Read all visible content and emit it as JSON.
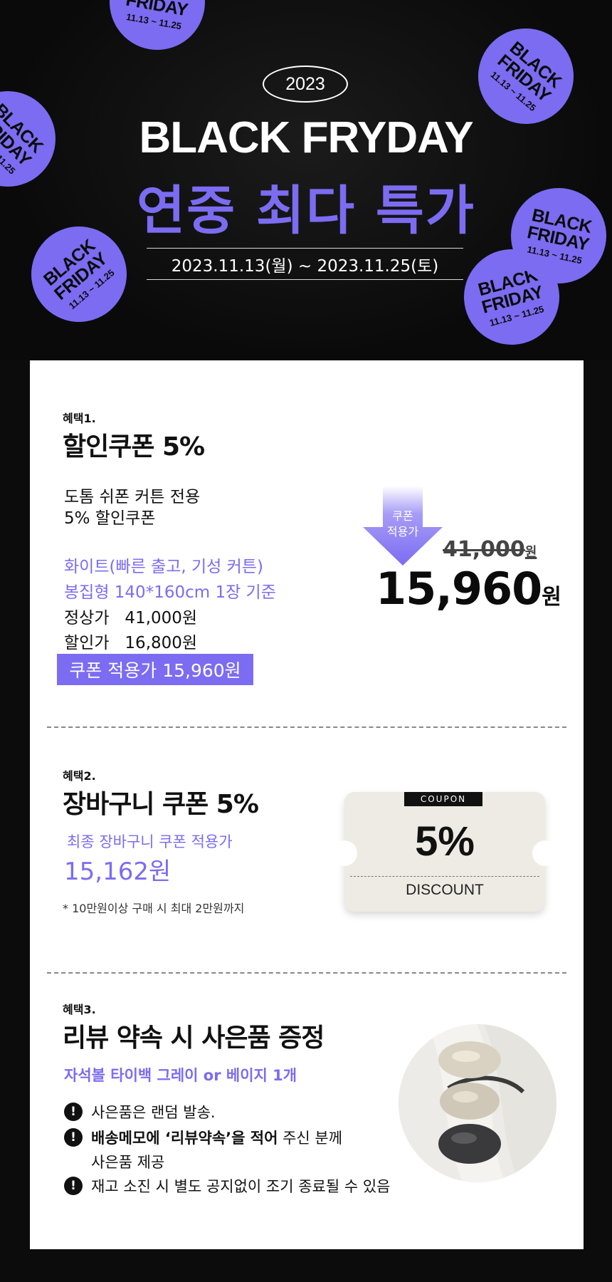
{
  "hero": {
    "year": "2023",
    "title": "BLACK FRYDAY",
    "subtitle": "연중 최다 특가",
    "period": "2023.11.13(월) ~ 2023.11.25(토)",
    "sticker_line1": "BLACK",
    "sticker_line2": "FRIDAY",
    "sticker_dates": "11.13 ~ 11.25"
  },
  "benefit1": {
    "tag": "혜택1.",
    "title": "할인쿠폰 5%",
    "desc_line1": "도톰 쉬폰 커튼 전용",
    "desc_line2": "5% 할인쿠폰",
    "option_line1": "화이트(빠른 출고, 기성 커튼)",
    "option_line2": "봉집형 140*160cm 1장 기준",
    "regular_label": "정상가",
    "regular_price": "41,000원",
    "sale_label": "할인가",
    "sale_price": "16,800원",
    "coupon_price_text": "쿠폰 적용가 15,960원",
    "arrow_line1": "쿠폰",
    "arrow_line2": "적용가",
    "old_price": "41,000",
    "old_price_unit": "원",
    "new_price": "15,960",
    "new_price_unit": "원"
  },
  "benefit2": {
    "tag": "혜택2.",
    "title": "장바구니 쿠폰 5%",
    "final_label": "최종 장바구니 쿠폰 적용가",
    "final_price": "15,162원",
    "note": "* 10만원이상 구매 시 최대 2만원까지",
    "ticket_label": "COUPON",
    "ticket_percent": "5%",
    "ticket_sub": "DISCOUNT"
  },
  "benefit3": {
    "tag": "혜택3.",
    "title": "리뷰 약속 시 사은품 증정",
    "gift": "자석볼 타이백 그레이 or 베이지 1개",
    "bullet_mark": "!",
    "bullet1": "사은품은 랜덤 발송.",
    "bullet2_bold": "배송메모에 ‘리뷰약속’을 적어",
    "bullet2_rest": " 주신 분께",
    "bullet2_line2": "사은품 제공",
    "bullet3": "재고 소진 시 별도 공지없이 조기 종료될 수 있음"
  },
  "colors": {
    "accent": "#7b6cf2",
    "background": "#0c0c0c",
    "card": "#ffffff"
  }
}
